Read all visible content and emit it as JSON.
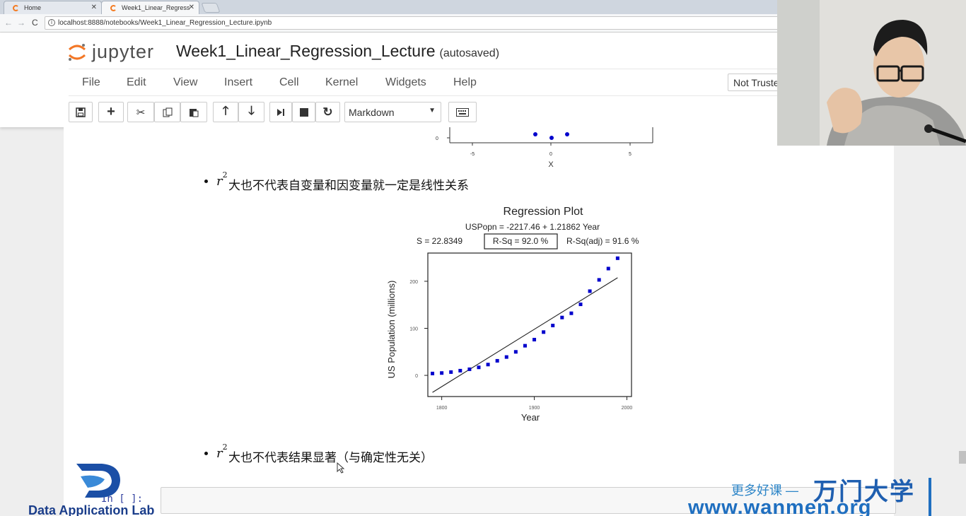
{
  "browser": {
    "tabs": [
      {
        "label": "Home",
        "active": false
      },
      {
        "label": "Week1_Linear_Regress",
        "active": true
      }
    ],
    "url": "localhost:8888/notebooks/Week1_Linear_Regression_Lecture.ipynb"
  },
  "jupyter": {
    "logo_text": "jupyter",
    "notebook_title": "Week1_Linear_Regression_Lecture",
    "save_status": "(autosaved)",
    "menu": [
      "File",
      "Edit",
      "View",
      "Insert",
      "Cell",
      "Kernel",
      "Widgets",
      "Help"
    ],
    "trust_label": "Not Truste",
    "cell_type": "Markdown"
  },
  "notebook": {
    "bullet1": "大也不代表自变量和因变量就一定是线性关系",
    "bullet2": "大也不代表结果显著（与确定性无关）",
    "math_symbol": "r",
    "math_exponent": "2",
    "input_prompt": "In [ ]:"
  },
  "top_fragment": {
    "tick_labels": [
      "-5",
      "0",
      "5"
    ],
    "y_tick": "0",
    "xlabel": "X",
    "points": [
      {
        "x": -1,
        "y": 0.35
      },
      {
        "x": 0,
        "y": 0
      },
      {
        "x": 1,
        "y": 0.35
      }
    ]
  },
  "chart_data": {
    "type": "scatter",
    "title": "Regression Plot",
    "equation": "USPopn = -2217.46 + 1.21862 Year",
    "stat_s": "S = 22.8349",
    "stat_rsq": "R-Sq = 92.0 %",
    "stat_rsq_adj": "R-Sq(adj) = 91.6 %",
    "xlabel": "Year",
    "ylabel": "US Population (millions)",
    "xlim": [
      1785,
      2005
    ],
    "ylim": [
      -45,
      260
    ],
    "xticks": [
      1800,
      1900,
      2000
    ],
    "xtick_labels": [
      "1800",
      "1900",
      "2000"
    ],
    "yticks": [
      0,
      100,
      200
    ],
    "ytick_labels": [
      "0",
      "100",
      "200"
    ],
    "x": [
      1790,
      1800,
      1810,
      1820,
      1830,
      1840,
      1850,
      1860,
      1870,
      1880,
      1890,
      1900,
      1910,
      1920,
      1930,
      1940,
      1950,
      1960,
      1970,
      1980,
      1990
    ],
    "y": [
      4,
      5,
      7,
      10,
      13,
      17,
      23,
      31,
      39,
      50,
      63,
      76,
      92,
      106,
      123,
      132,
      151,
      179,
      203,
      227,
      249
    ],
    "fit": {
      "intercept": -2217.46,
      "slope": 1.21862,
      "x_range": [
        1790,
        1990
      ]
    },
    "point_color": "#0000cc"
  },
  "watermark": {
    "org_text": "Data Application Lab",
    "cn_text": "更多好课 —",
    "brand": "万门大学",
    "url": "www.wanmen.org"
  }
}
